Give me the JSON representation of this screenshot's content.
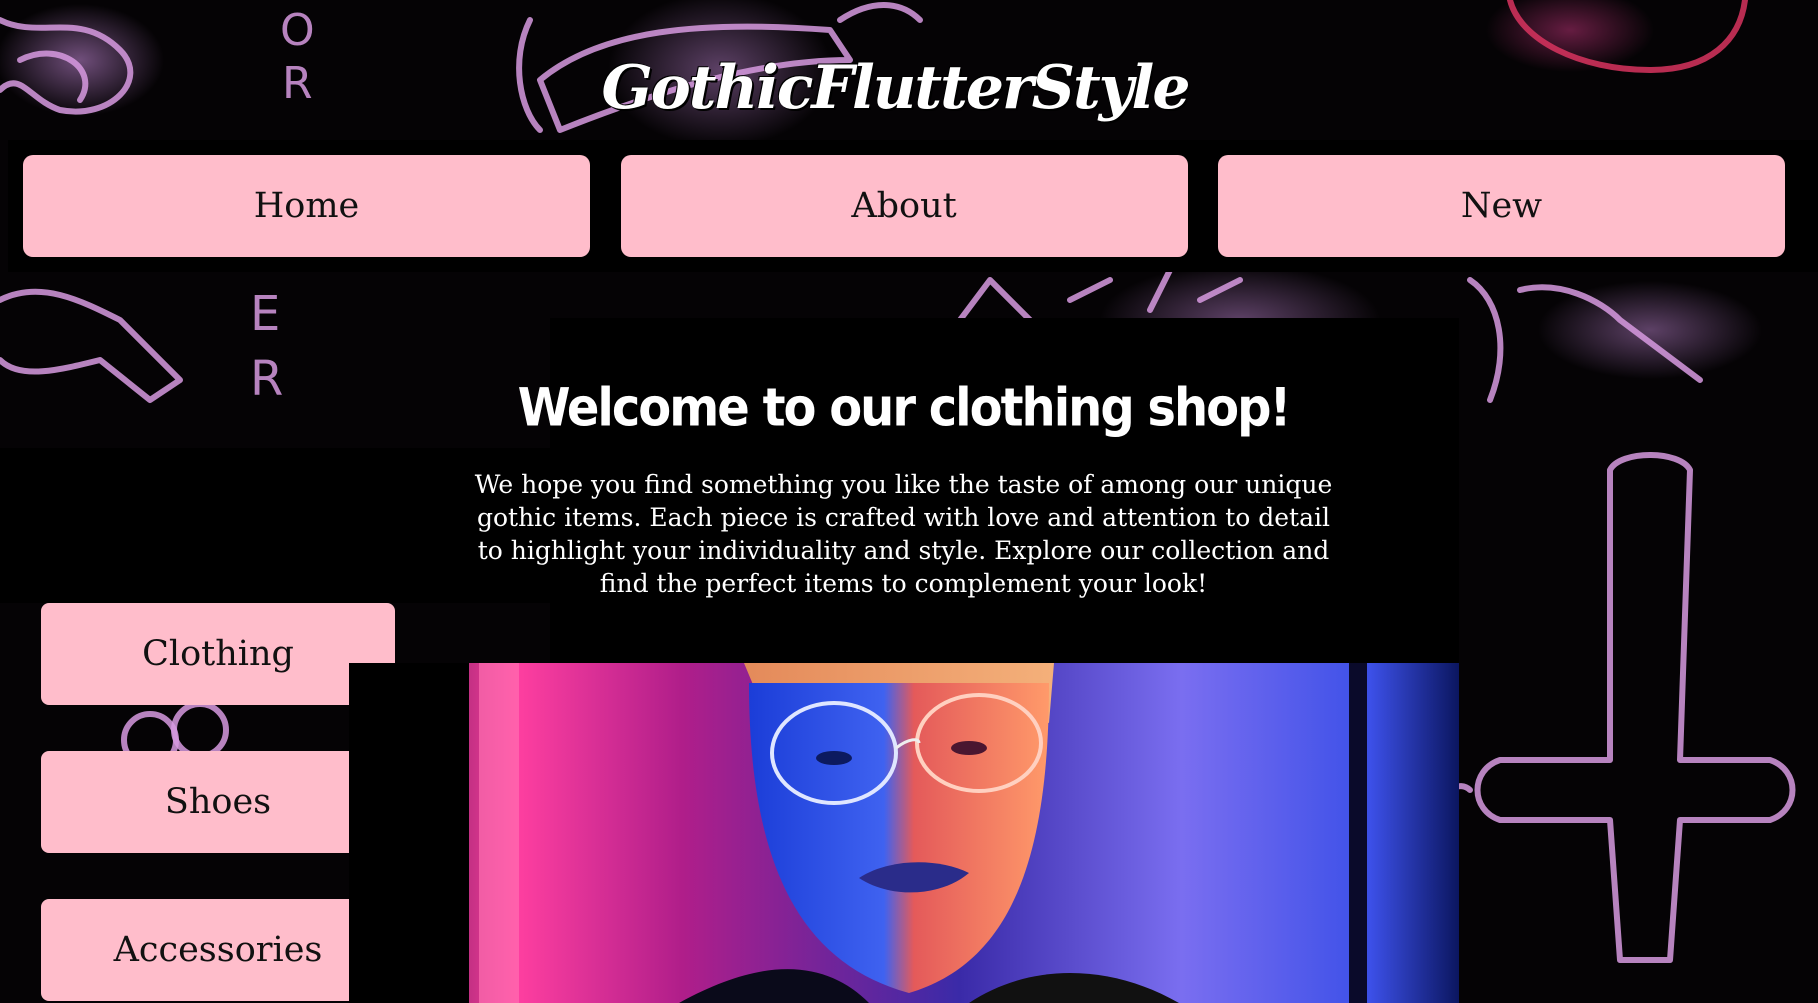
{
  "header": {
    "logo_text": "GothicFlutterStyle"
  },
  "top_nav": {
    "items": [
      {
        "label": "Home"
      },
      {
        "label": "About"
      },
      {
        "label": "New"
      }
    ]
  },
  "side_nav": {
    "items": [
      {
        "label": "Clothing"
      },
      {
        "label": "Shoes"
      },
      {
        "label": "Accessories"
      }
    ]
  },
  "main": {
    "title": "Welcome to our clothing shop!",
    "intro": "We hope you find something you like the taste of  among our unique gothic items. Each piece is crafted with love and attention to detail to highlight your individuality and style. Explore our collection and find the perfect items to complement your look!"
  },
  "colors": {
    "button_bg": "#ffbdcb",
    "page_bg": "#000000",
    "doodle": "#d79ae0",
    "text_light": "#ffffff"
  }
}
